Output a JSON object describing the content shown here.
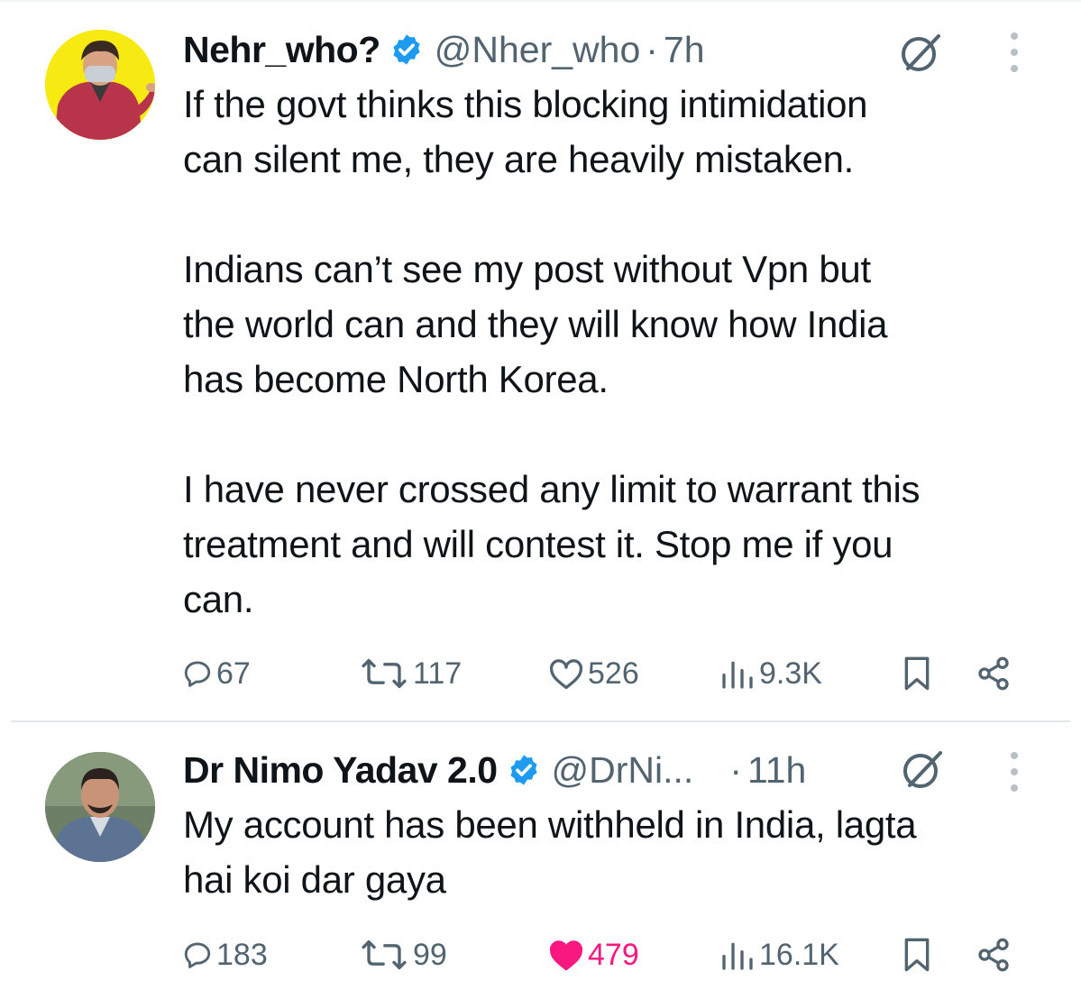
{
  "tweets": [
    {
      "author_name": "Nehr_who?",
      "handle": "@Nher_who",
      "separator": "·",
      "time": "7h",
      "text": "If the govt thinks this blocking intimidation\ncan silent me, they are heavily mistaken.\n\nIndians can’t see my post without Vpn but\nthe world can and they will know how India\nhas become North Korea.\n\nI have never crossed any limit to warrant this\ntreatment and will contest it. Stop me if you\ncan.",
      "replies": "67",
      "reposts": "117",
      "likes": "526",
      "views": "9.3K",
      "liked": false
    },
    {
      "author_name": "Dr Nimo Yadav 2.0",
      "handle": "@DrNi...",
      "separator": "·",
      "time": "11h",
      "text": "My account has been withheld in India, lagta\nhai koi dar gaya",
      "replies": "183",
      "reposts": "99",
      "likes": "479",
      "views": "16.1K",
      "liked": true
    }
  ],
  "colors": {
    "verified": "#1d9bf0",
    "like_active": "#f91880",
    "secondary_text": "#536471",
    "divider": "#e1e6ea"
  },
  "icons": [
    "verified-badge-icon",
    "grok-icon",
    "more-icon",
    "reply-icon",
    "repost-icon",
    "like-icon",
    "views-icon",
    "bookmark-icon",
    "share-icon"
  ]
}
